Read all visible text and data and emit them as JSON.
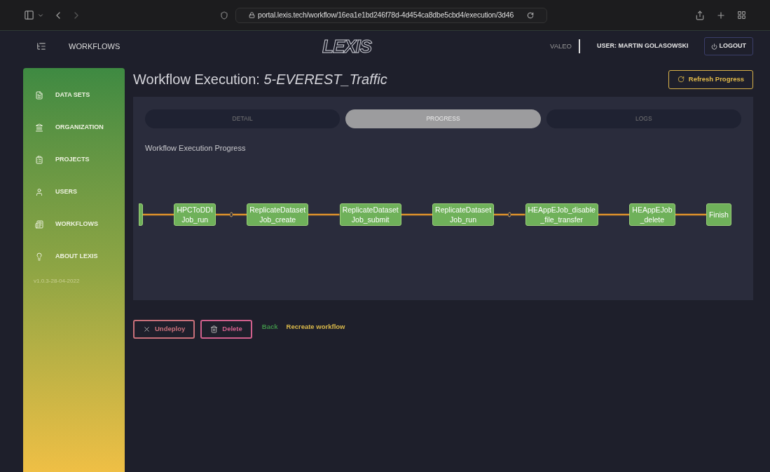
{
  "browser": {
    "url": "portal.lexis.tech/workflow/16ea1e1bd246f78d-4d454ca8dbe5cbd4/execution/3d46"
  },
  "header": {
    "section": "WORKFLOWS",
    "logo": "LEXIS",
    "organization": "VALEO",
    "user": "USER: MARTIN GOLASOWSKI",
    "logout": "LOGOUT"
  },
  "sidebar": {
    "items": [
      {
        "label": "DATA SETS"
      },
      {
        "label": "ORGANIZATION"
      },
      {
        "label": "PROJECTS"
      },
      {
        "label": "USERS"
      },
      {
        "label": "WORKFLOWS"
      },
      {
        "label": "ABOUT LEXIS"
      }
    ],
    "version": "v1.0.3-28-04-2022"
  },
  "title": {
    "prefix": "Workflow Execution: ",
    "name": "5-EVEREST_Traffic"
  },
  "refresh_button": "Refresh Progress",
  "tabs": [
    {
      "label": "DETAIL",
      "selected": false
    },
    {
      "label": "PROGRESS",
      "selected": true
    },
    {
      "label": "LOGS",
      "selected": false
    }
  ],
  "progress": {
    "heading": "Workflow Execution Progress",
    "nodes": [
      {
        "kind": "cut"
      },
      {
        "kind": "task",
        "lines": [
          "HPCToDDI",
          "Job_run"
        ]
      },
      {
        "kind": "task",
        "lines": [
          "ReplicateDataset",
          "Job_create"
        ]
      },
      {
        "kind": "task",
        "lines": [
          "ReplicateDataset",
          "Job_submit"
        ]
      },
      {
        "kind": "task",
        "lines": [
          "ReplicateDataset",
          "Job_run"
        ]
      },
      {
        "kind": "task",
        "lines": [
          "HEAppEJob_disable",
          "_file_transfer"
        ]
      },
      {
        "kind": "task",
        "lines": [
          "HEAppEJob",
          "_delete"
        ]
      },
      {
        "kind": "task",
        "lines": [
          "Finish"
        ]
      }
    ],
    "edges": [
      {
        "kind": "plain"
      },
      {
        "kind": "dot"
      },
      {
        "kind": "plain"
      },
      {
        "kind": "plain"
      },
      {
        "kind": "dot"
      },
      {
        "kind": "plain"
      },
      {
        "kind": "plain"
      }
    ]
  },
  "actions": [
    {
      "kind": "outline",
      "label": "Undeploy",
      "color": "#c8707a"
    },
    {
      "kind": "outline",
      "label": "Delete",
      "color": "#d0608c"
    },
    {
      "kind": "link",
      "label": "Back",
      "color": "#3f8f48"
    },
    {
      "kind": "link",
      "label": "Recreate workflow",
      "color": "#d9b84a"
    }
  ]
}
